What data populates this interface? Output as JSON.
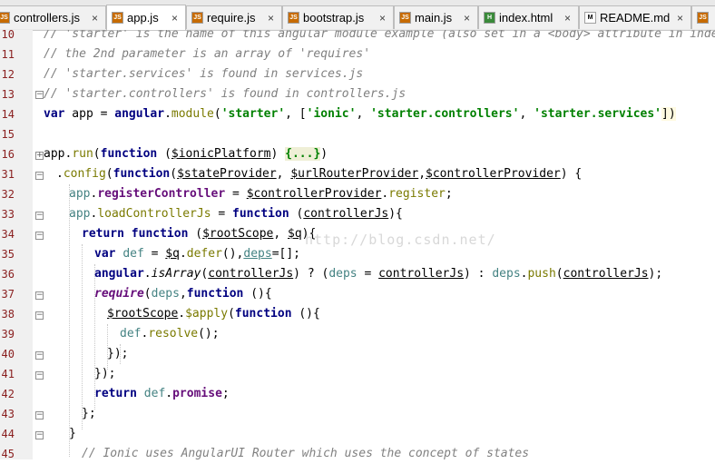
{
  "tabs": [
    {
      "label": "controllers.js",
      "icon": "js-file-icon",
      "active": false
    },
    {
      "label": "app.js",
      "icon": "js-file-icon",
      "active": true
    },
    {
      "label": "require.js",
      "icon": "js-file-icon",
      "active": false
    },
    {
      "label": "bootstrap.js",
      "icon": "js-file-icon",
      "active": false
    },
    {
      "label": "main.js",
      "icon": "js-file-icon",
      "active": false
    },
    {
      "label": "index.html",
      "icon": "html-file-icon",
      "active": false
    },
    {
      "label": "README.md",
      "icon": "md-file-icon",
      "active": false
    }
  ],
  "close_glyph": "×",
  "line_numbers": [
    "10",
    "11",
    "12",
    "13",
    "14",
    "15",
    "16",
    "31",
    "32",
    "33",
    "34",
    "35",
    "36",
    "37",
    "38",
    "39",
    "40",
    "41",
    "42",
    "43",
    "44",
    "45"
  ],
  "watermark": "http://blog.csdn.net/",
  "code": {
    "l10": "// 'starter' is the name of this angular module example (also set in a <body> attribute in index.html)",
    "l11": "// the 2nd parameter is an array of 'requires'",
    "l12": "// 'starter.services' is found in services.js",
    "l13": "// 'starter.controllers' is found in controllers.js",
    "l14": [
      "var",
      " app = ",
      "angular",
      ".",
      "module",
      "(",
      "'starter'",
      ", [",
      "'ionic'",
      ", ",
      "'starter.controllers'",
      ", ",
      "'starter.services'",
      "])"
    ],
    "l16": [
      "app",
      ".",
      "run",
      "(",
      "function",
      " (",
      "$ionicPlatform",
      ") ",
      "{...}",
      ")"
    ],
    "l31": [
      ".",
      "config",
      "(",
      "function",
      "(",
      "$stateProvider",
      ", ",
      "$urlRouterProvider",
      ",",
      "$controllerProvider",
      ") {"
    ],
    "l32": [
      "app",
      ".",
      "registerController",
      " = ",
      "$controllerProvider",
      ".",
      "register",
      ";"
    ],
    "l33": [
      "app",
      ".",
      "loadControllerJs",
      " = ",
      "function",
      " (",
      "controllerJs",
      "){"
    ],
    "l34": [
      "return",
      " ",
      "function",
      " (",
      "$rootScope",
      ", ",
      "$q",
      "){"
    ],
    "l35": [
      "var",
      " ",
      "def",
      " = ",
      "$q",
      ".",
      "defer",
      "(),",
      "deps",
      "=[];"
    ],
    "l36": [
      "angular",
      ".",
      "isArray",
      "(",
      "controllerJs",
      ") ? (",
      "deps",
      " = ",
      "controllerJs",
      ") : ",
      "deps",
      ".",
      "push",
      "(",
      "controllerJs",
      ");"
    ],
    "l37": [
      "require",
      "(",
      "deps",
      ",",
      "function",
      " (){"
    ],
    "l38": [
      "$rootScope",
      ".",
      "$apply",
      "(",
      "function",
      " (){"
    ],
    "l39": [
      "def",
      ".",
      "resolve",
      "();"
    ],
    "l40": "});",
    "l41": "});",
    "l42": [
      "return",
      " ",
      "def",
      ".",
      "promise",
      ";"
    ],
    "l43": "};",
    "l44": "}",
    "l45": "// Ionic uses AngularUI Router which uses the concept of states"
  }
}
